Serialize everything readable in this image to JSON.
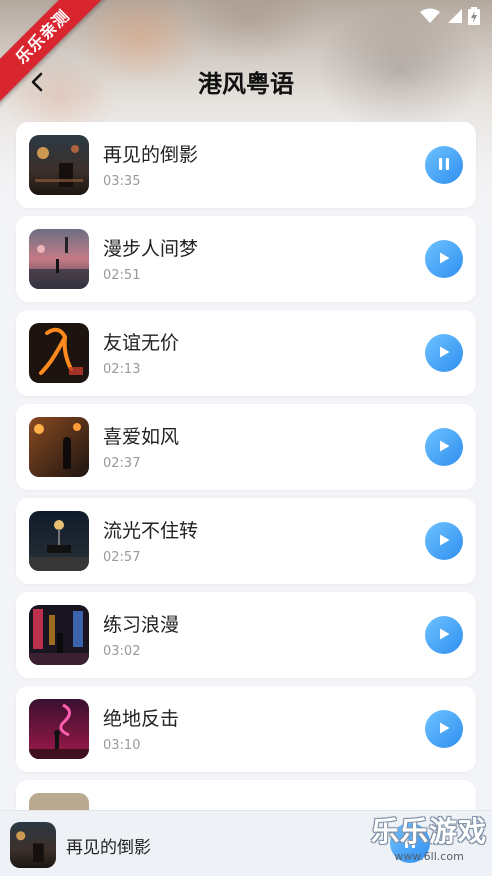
{
  "header": {
    "title": "港风粤语",
    "back_icon": "chevron-left-icon"
  },
  "ribbon": {
    "label": "乐乐亲测",
    "color": "#d9262e"
  },
  "status_bar": {
    "icons": [
      "wifi-icon",
      "signal-icon",
      "battery-charging-icon"
    ]
  },
  "songs": [
    {
      "title": "再见的倒影",
      "duration": "03:35",
      "state": "playing",
      "action_icon": "pause-icon"
    },
    {
      "title": "漫步人间梦",
      "duration": "02:51",
      "state": "paused",
      "action_icon": "play-icon"
    },
    {
      "title": "友谊无价",
      "duration": "02:13",
      "state": "paused",
      "action_icon": "play-icon"
    },
    {
      "title": "喜爱如风",
      "duration": "02:37",
      "state": "paused",
      "action_icon": "play-icon"
    },
    {
      "title": "流光不住转",
      "duration": "02:57",
      "state": "paused",
      "action_icon": "play-icon"
    },
    {
      "title": "练习浪漫",
      "duration": "03:02",
      "state": "paused",
      "action_icon": "play-icon"
    },
    {
      "title": "绝地反击",
      "duration": "03:10",
      "state": "paused",
      "action_icon": "play-icon"
    }
  ],
  "mini_player": {
    "title": "再见的倒影"
  },
  "watermark": {
    "main": "乐乐游戏",
    "url": "www.6ll.com"
  },
  "colors": {
    "accent": "#2f8ff0",
    "accent_light": "#6ec2ff",
    "duration_text": "#9a9a9a"
  }
}
